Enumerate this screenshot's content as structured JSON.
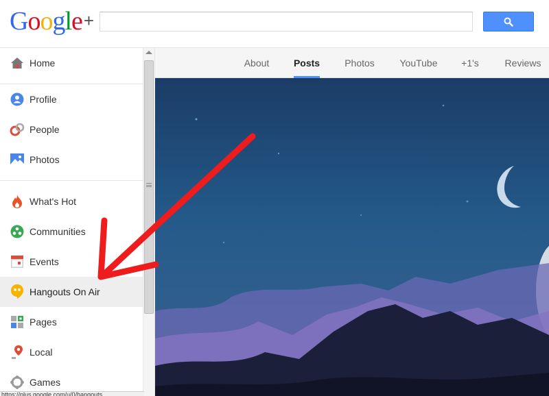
{
  "header": {
    "logo_letters": [
      "G",
      "o",
      "o",
      "g",
      "l",
      "e"
    ],
    "logo_plus": "+",
    "search_placeholder": ""
  },
  "colors": {
    "logo": [
      "#3369e8",
      "#d50f25",
      "#eeb211",
      "#3369e8",
      "#009925",
      "#d50f25"
    ],
    "accent": "#4d90fe",
    "arrow": "#ee1c1c"
  },
  "sidebar": {
    "items": [
      {
        "label": "Home",
        "icon": "home-icon"
      },
      {
        "label": "Profile",
        "icon": "profile-icon"
      },
      {
        "label": "People",
        "icon": "people-icon"
      },
      {
        "label": "Photos",
        "icon": "photos-icon"
      },
      {
        "label": "What's Hot",
        "icon": "flame-icon"
      },
      {
        "label": "Communities",
        "icon": "communities-icon"
      },
      {
        "label": "Events",
        "icon": "calendar-icon"
      },
      {
        "label": "Hangouts On Air",
        "icon": "hangouts-icon",
        "active": true
      },
      {
        "label": "Pages",
        "icon": "pages-icon"
      },
      {
        "label": "Local",
        "icon": "location-pin-icon"
      },
      {
        "label": "Games",
        "icon": "games-icon"
      }
    ]
  },
  "status_url": "https://plus.google.com/u/0/hangouts",
  "tabs": [
    {
      "label": "About"
    },
    {
      "label": "Posts",
      "active": true
    },
    {
      "label": "Photos"
    },
    {
      "label": "YouTube"
    },
    {
      "label": "+1's"
    },
    {
      "label": "Reviews"
    }
  ]
}
